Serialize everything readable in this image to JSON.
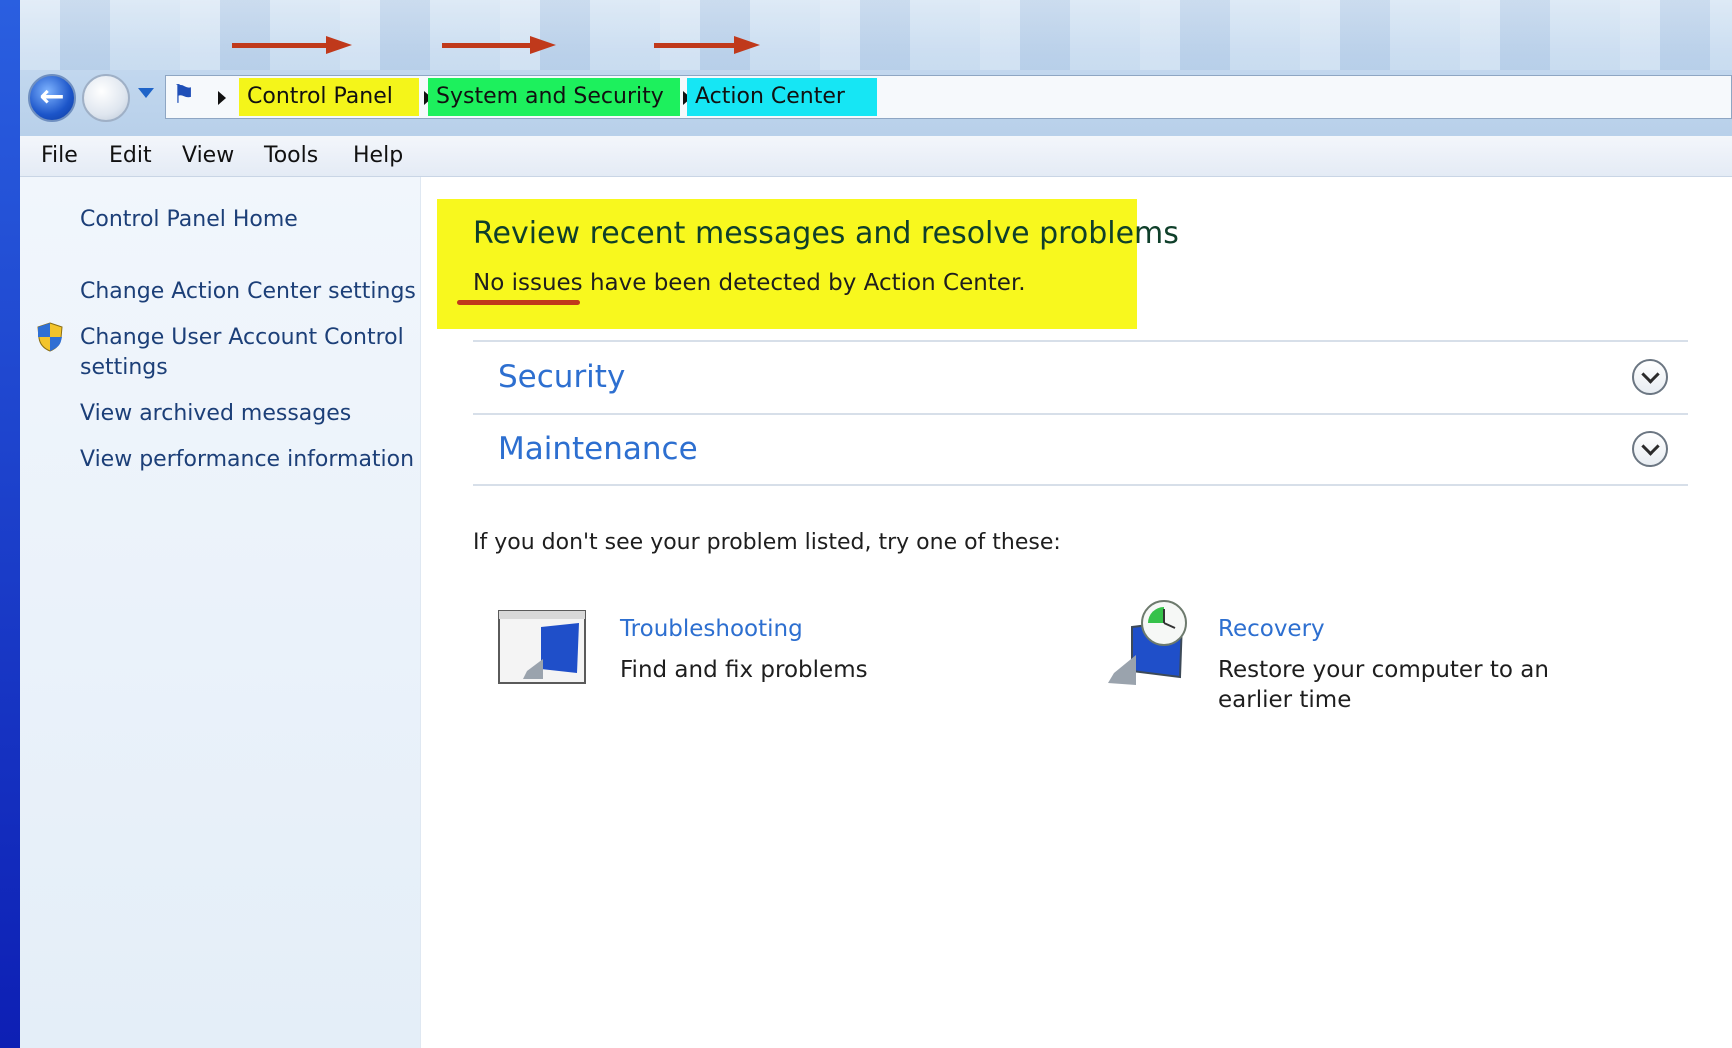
{
  "breadcrumb": {
    "items": [
      "Control Panel",
      "System and Security",
      "Action Center"
    ],
    "colors": [
      "#f4f51a",
      "#1df05d",
      "#16e6f4"
    ]
  },
  "menu": [
    "File",
    "Edit",
    "View",
    "Tools",
    "Help"
  ],
  "sidebar": {
    "items": [
      {
        "label": "Control Panel Home"
      },
      {
        "label": "Change Action Center settings"
      },
      {
        "label": "Change User Account Control settings",
        "icon": "uac-shield-icon"
      },
      {
        "label": "View archived messages"
      },
      {
        "label": "View performance information"
      }
    ]
  },
  "main": {
    "title": "Review recent messages and resolve problems",
    "status": "No issues have been detected by Action Center.",
    "highlight_color": "#f8f81e",
    "sections": [
      {
        "label": "Security",
        "expand_icon": "chevron-down-icon"
      },
      {
        "label": "Maintenance",
        "expand_icon": "chevron-down-icon"
      }
    ],
    "hint": "If you don't see your problem listed, try one of these:",
    "tasks": [
      {
        "title": "Troubleshooting",
        "description": "Find and fix problems",
        "icon": "troubleshooting-icon"
      },
      {
        "title": "Recovery",
        "description": "Restore your computer to an earlier time",
        "icon": "recovery-icon"
      }
    ]
  },
  "annotation_color": "#c0391b"
}
